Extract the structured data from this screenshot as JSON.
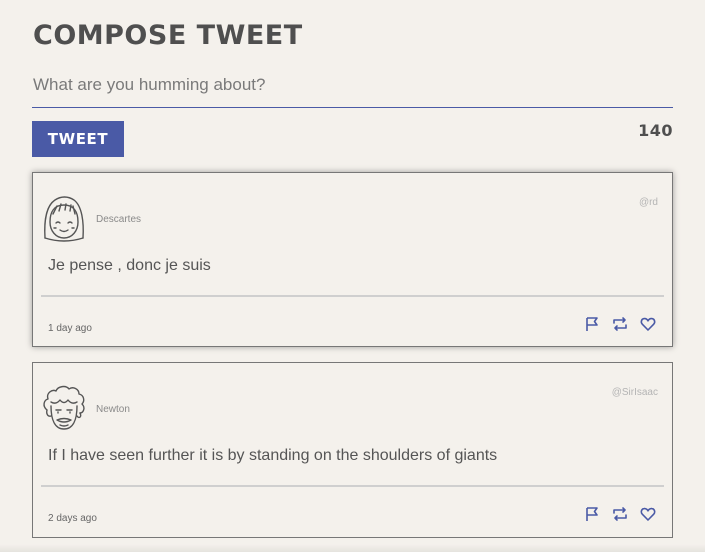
{
  "compose": {
    "title": "Compose Tweet",
    "placeholder": "What are you humming about?",
    "button_label": "Tweet",
    "char_count": "140"
  },
  "tweets": [
    {
      "name": "Descartes",
      "handle": "@rd",
      "text": "Je pense , donc je suis",
      "time": "1 day ago",
      "avatar_icon": "girl-face-icon"
    },
    {
      "name": "Newton",
      "handle": "@SirIsaac",
      "text": "If I have seen further it is by standing on the shoulders of giants",
      "time": "2 days ago",
      "avatar_icon": "curly-hair-face-icon"
    }
  ],
  "colors": {
    "background": "#f4f1ec",
    "accent": "#4a5aa6",
    "text": "#4a4a4a"
  }
}
